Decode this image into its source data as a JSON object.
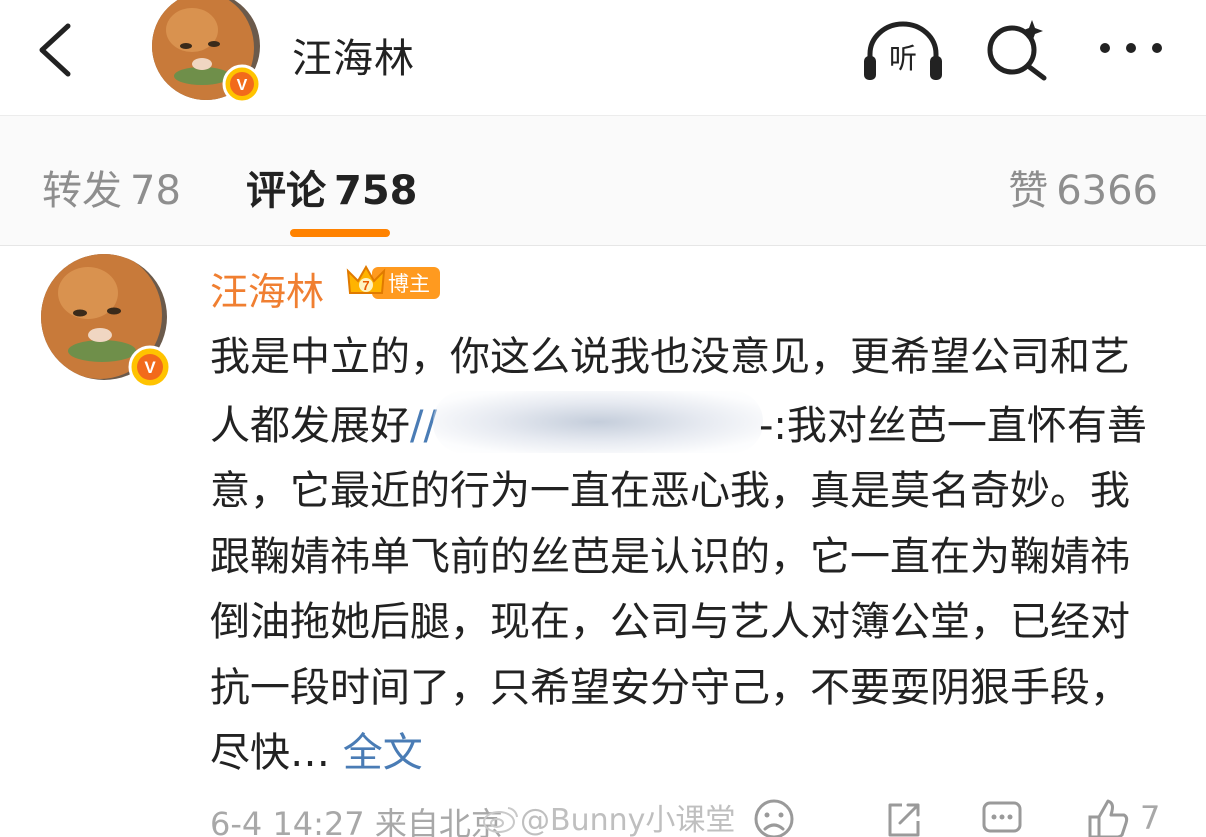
{
  "header": {
    "title": "汪海林",
    "listen_label": "听",
    "verified_mark": "V"
  },
  "tabs": {
    "reposts": {
      "label": "转发",
      "count": "78"
    },
    "comments": {
      "label": "评论",
      "count": "758"
    },
    "likes": {
      "label": "赞",
      "count": "6366"
    }
  },
  "comment": {
    "author": "汪海林",
    "badge_label": "博主",
    "badge_level": "7",
    "text_part1": "我是中立的，你这么说我也没意见，更希望公司和艺人都发展好",
    "text_part2_prefix": "//",
    "text_part2_tail": "-:我对丝芭一直怀有善意，它最近的行为一直在恶心我，真是莫名奇妙。我跟鞠婧祎单飞前的丝芭是认识的，它一直在为鞠婧祎倒油拖她后腿，现在，公司与艺人对簿公堂，已经对抗一段时间了，只希望安分守己，不要耍阴狠手段，尽快…",
    "full_text_link": " 全文",
    "time": "6-4 14:27",
    "source": "来自北京",
    "like_count": "7",
    "watermark": "@Bunny小课堂"
  },
  "colors": {
    "accent_orange": "#ff8200",
    "name_orange": "#f07f31",
    "link_blue": "#4a7cb5",
    "muted_gray": "#8e8e8e"
  },
  "icons": [
    "back-arrow-icon",
    "headphones-icon",
    "search-sparkle-icon",
    "more-dots-icon",
    "verified-v-icon",
    "crown-icon",
    "sad-emoji-icon",
    "share-icon",
    "comment-icon",
    "like-icon"
  ]
}
